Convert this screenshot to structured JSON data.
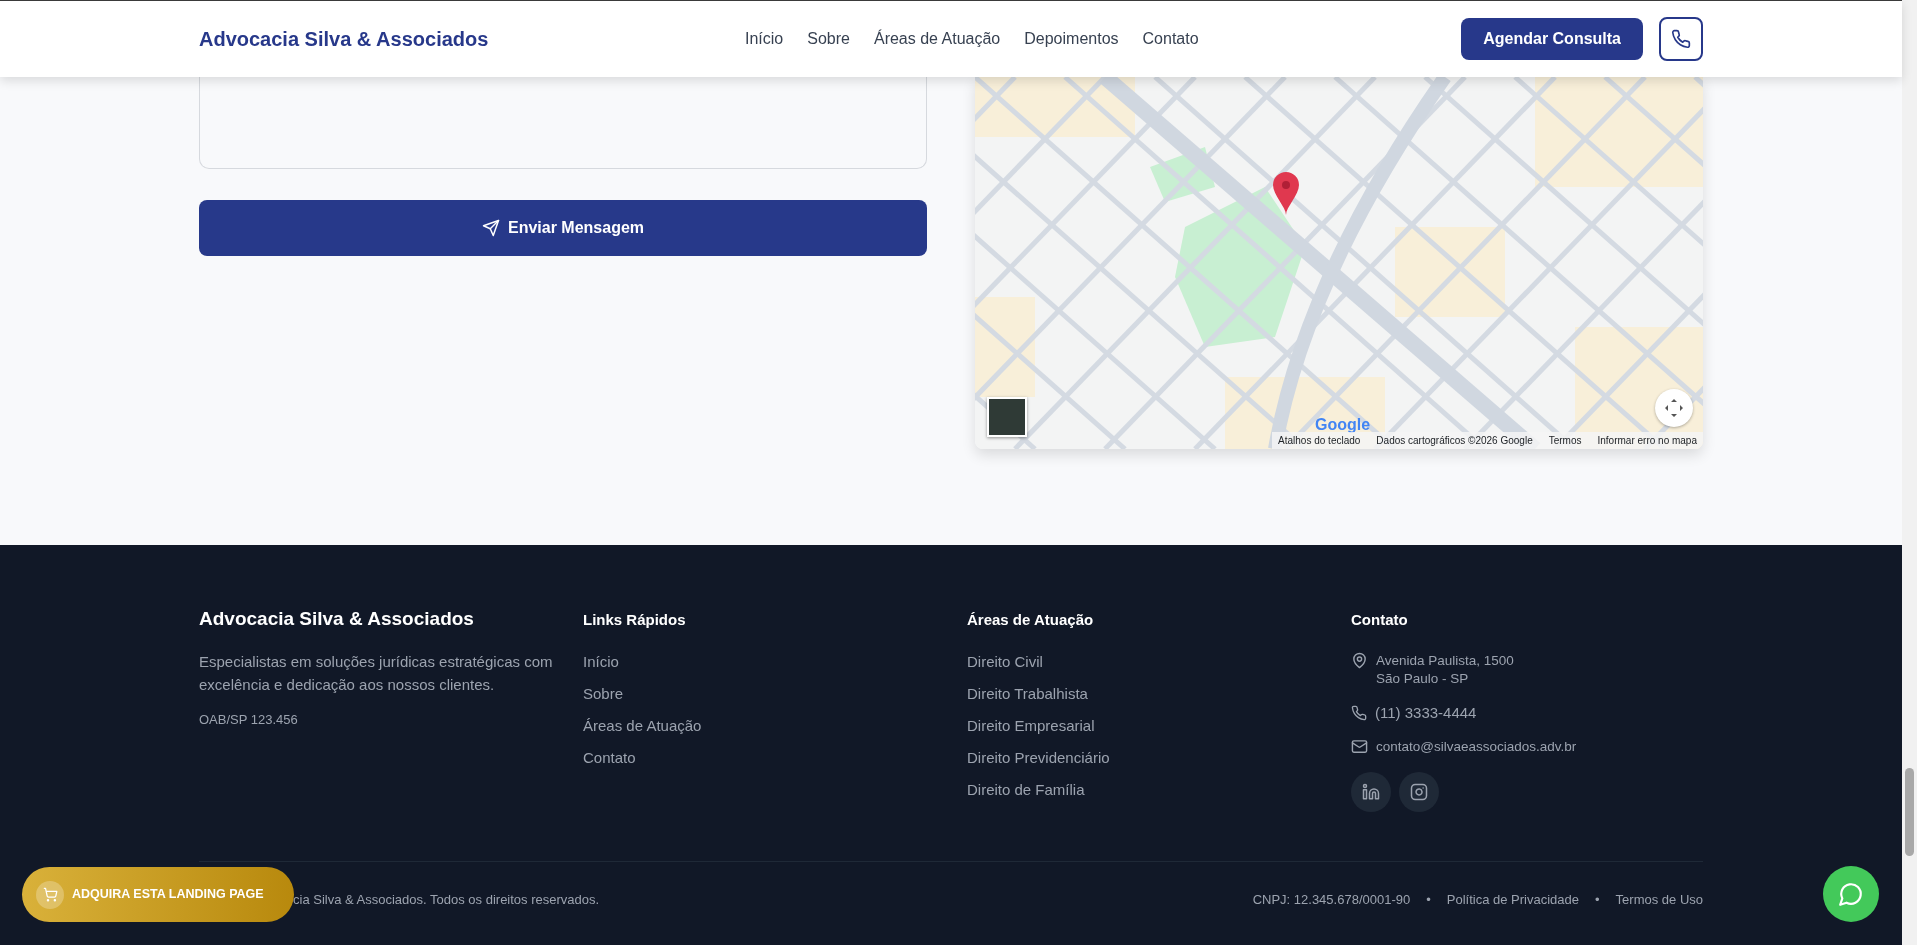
{
  "header": {
    "brand": "Advocacia Silva & Associados",
    "nav": [
      {
        "label": "Início"
      },
      {
        "label": "Sobre"
      },
      {
        "label": "Áreas de Atuação"
      },
      {
        "label": "Depoimentos"
      },
      {
        "label": "Contato"
      }
    ],
    "cta": "Agendar Consulta"
  },
  "contact_form": {
    "submit": "Enviar Mensagem"
  },
  "map": {
    "logo": "Google",
    "attribution": [
      "Atalhos do teclado",
      "Dados cartográficos ©2026 Google",
      "Termos",
      "Informar erro no mapa"
    ]
  },
  "footer": {
    "brand": "Advocacia Silva & Associados",
    "description": "Especialistas em soluções jurídicas estratégicas com excelência e dedicação aos nossos clientes.",
    "oab": "OAB/SP 123.456",
    "columns": [
      {
        "heading": "Links Rápidos",
        "links": [
          "Início",
          "Sobre",
          "Áreas de Atuação",
          "Contato"
        ]
      },
      {
        "heading": "Áreas de Atuação",
        "links": [
          "Direito Civil",
          "Direito Trabalhista",
          "Direito Empresarial",
          "Direito Previdenciário",
          "Direito de Família"
        ]
      }
    ],
    "contact": {
      "heading": "Contato",
      "address": [
        "Avenida Paulista, 1500",
        "São Paulo - SP"
      ],
      "phone": "(11) 3333-4444",
      "email": "contato@silvaeassociados.adv.br"
    },
    "copyright": "cia Silva & Associados. Todos os direitos reservados.",
    "legal": [
      "CNPJ: 12.345.678/0001-90",
      "Política de Privacidade",
      "Termos de Uso"
    ],
    "separator": "•"
  },
  "promo_button": "ADQUIRA ESTA LANDING PAGE"
}
